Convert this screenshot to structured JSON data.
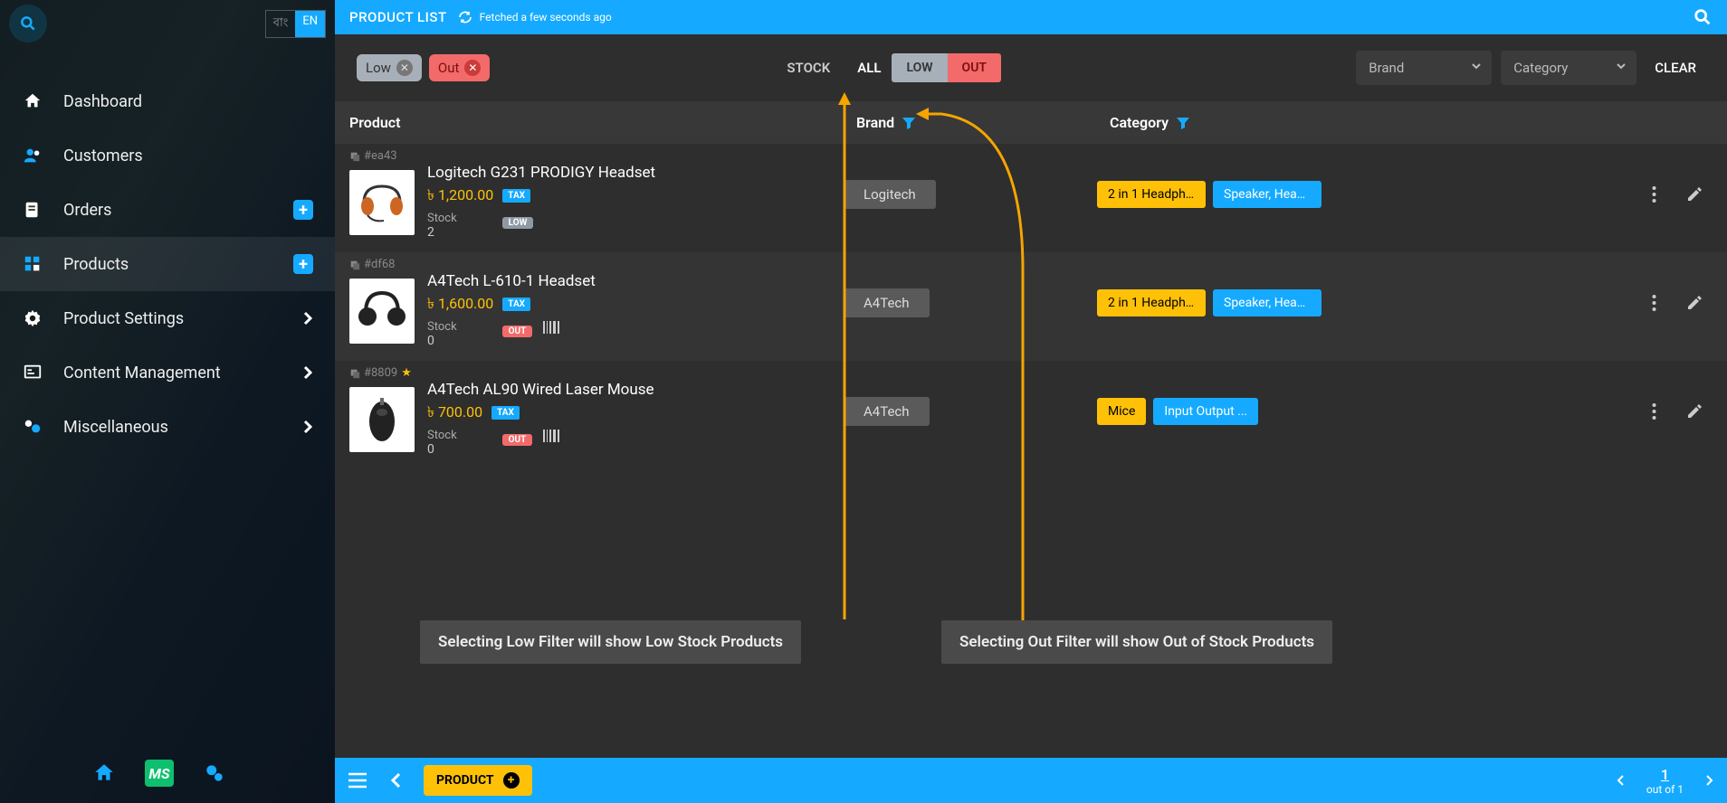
{
  "sidebar": {
    "lang": {
      "opt1": "বাং",
      "opt2": "EN"
    },
    "items": [
      {
        "label": "Dashboard"
      },
      {
        "label": "Customers"
      },
      {
        "label": "Orders"
      },
      {
        "label": "Products"
      },
      {
        "label": "Product Settings"
      },
      {
        "label": "Content Management"
      },
      {
        "label": "Miscellaneous"
      }
    ],
    "ms": "MS"
  },
  "topbar": {
    "title": "PRODUCT LIST",
    "fetched": "Fetched a few seconds ago"
  },
  "filters": {
    "chip_low": "Low",
    "chip_out": "Out",
    "stock_label": "STOCK",
    "all": "ALL",
    "low": "LOW",
    "out": "OUT",
    "brand_dd": "Brand",
    "category_dd": "Category",
    "clear": "CLEAR"
  },
  "table": {
    "head_product": "Product",
    "head_brand": "Brand",
    "head_category": "Category",
    "stock_label": "Stock",
    "tax": "TAX",
    "low_badge": "LOW",
    "out_badge": "OUT"
  },
  "products": [
    {
      "id": "#ea43",
      "starred": false,
      "name": "Logitech G231 PRODIGY Headset",
      "price": "৳  1,200.00",
      "stock": "2",
      "stock_status": "LOW",
      "brand": "Logitech",
      "cat1": "2 in 1 Headpho...",
      "cat2": "Speaker, Head..."
    },
    {
      "id": "#df68",
      "starred": false,
      "name": "A4Tech L-610-1 Headset",
      "price": "৳  1,600.00",
      "stock": "0",
      "stock_status": "OUT",
      "brand": "A4Tech",
      "cat1": "2 in 1 Headpho...",
      "cat2": "Speaker, Head..."
    },
    {
      "id": "#8809",
      "starred": true,
      "name": "A4Tech AL90 Wired Laser Mouse",
      "price": "৳  700.00",
      "stock": "0",
      "stock_status": "OUT",
      "brand": "A4Tech",
      "cat1": "Mice",
      "cat2": "Input Output ..."
    }
  ],
  "annotations": {
    "low": "Selecting Low Filter will show Low Stock Products",
    "out": "Selecting Out Filter will show Out of Stock Products"
  },
  "bottombar": {
    "product_btn": "PRODUCT",
    "page": "1",
    "out_of": "out of 1"
  }
}
